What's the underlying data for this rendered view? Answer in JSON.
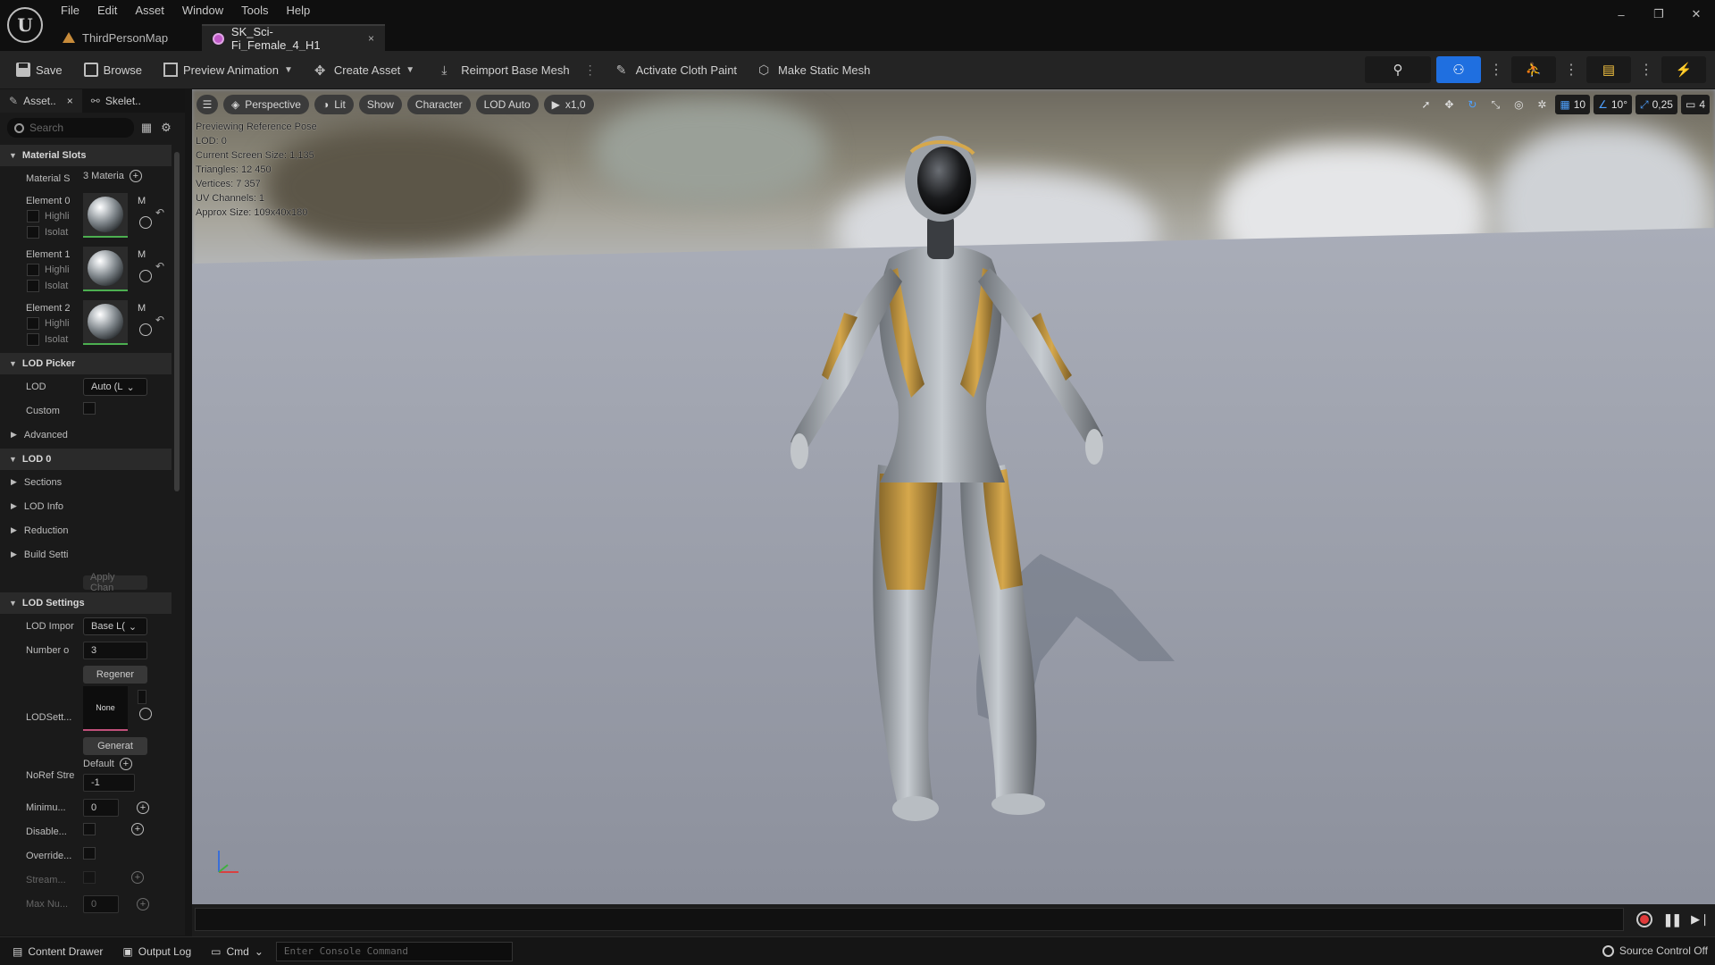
{
  "menu": [
    "File",
    "Edit",
    "Asset",
    "Window",
    "Tools",
    "Help"
  ],
  "tabs": {
    "map": "ThirdPersonMap",
    "asset": "SK_Sci-Fi_Female_4_H1",
    "close": "×"
  },
  "window_controls": {
    "minimize": "–",
    "restore": "❐",
    "close": "✕"
  },
  "toolbar": {
    "save": "Save",
    "browse": "Browse",
    "preview_animation": "Preview Animation",
    "create_asset": "Create Asset",
    "reimport": "Reimport Base Mesh",
    "cloth_paint": "Activate Cloth Paint",
    "static_mesh": "Make Static Mesh"
  },
  "left_panel": {
    "tab_asset": "Asset..",
    "tab_skeleton": "Skelet..",
    "search_placeholder": "Search",
    "material_slots": {
      "header": "Material Slots",
      "slots_label": "Material S",
      "slots_value": "3 Materia",
      "elements": [
        {
          "label": "Element 0",
          "highlight": "Highli",
          "isolate": "Isolat",
          "m": "M"
        },
        {
          "label": "Element 1",
          "highlight": "Highli",
          "isolate": "Isolat",
          "m": "M"
        },
        {
          "label": "Element 2",
          "highlight": "Highli",
          "isolate": "Isolat",
          "m": "M"
        }
      ]
    },
    "lod_picker": {
      "header": "LOD Picker",
      "lod_label": "LOD",
      "lod_value": "Auto (L",
      "custom_label": "Custom",
      "advanced": "Advanced"
    },
    "lod0": {
      "header": "LOD 0",
      "sections": "Sections",
      "lod_info": "LOD Info",
      "reduction": "Reduction",
      "build": "Build Setti",
      "apply": "Apply Chan"
    },
    "lod_settings": {
      "header": "LOD Settings",
      "import_label": "LOD Impor",
      "import_value": "Base L(",
      "number_label": "Number o",
      "number_value": "3",
      "regen": "Regener",
      "lodsett_label": "LODSett...",
      "none": "None",
      "generate": "Generat",
      "noref_label": "NoRef Stre",
      "noref_default": "Default",
      "noref_value": "-1",
      "minimum_label": "Minimu...",
      "minimum_value": "0",
      "disable_label": "Disable...",
      "override_label": "Override...",
      "stream_label": "Stream...",
      "maxnu_label": "Max Nu...",
      "maxnu_value": "0"
    }
  },
  "viewport": {
    "perspective": "Perspective",
    "lit": "Lit",
    "show": "Show",
    "character": "Character",
    "lod_auto": "LOD Auto",
    "speed": "x1,0",
    "grid_snap": "10",
    "rot_snap": "10°",
    "scale_snap": "0,25",
    "camera_speed": "4",
    "stats": [
      "Previewing Reference Pose",
      "LOD: 0",
      "Current Screen Size: 1,135",
      "Triangles: 12 450",
      "Vertices: 7 357",
      "UV Channels: 1",
      "Approx Size: 109x40x180"
    ]
  },
  "statusbar": {
    "content_drawer": "Content Drawer",
    "output_log": "Output Log",
    "cmd": "Cmd",
    "console_placeholder": "Enter Console Command",
    "source_control": "Source Control Off"
  }
}
